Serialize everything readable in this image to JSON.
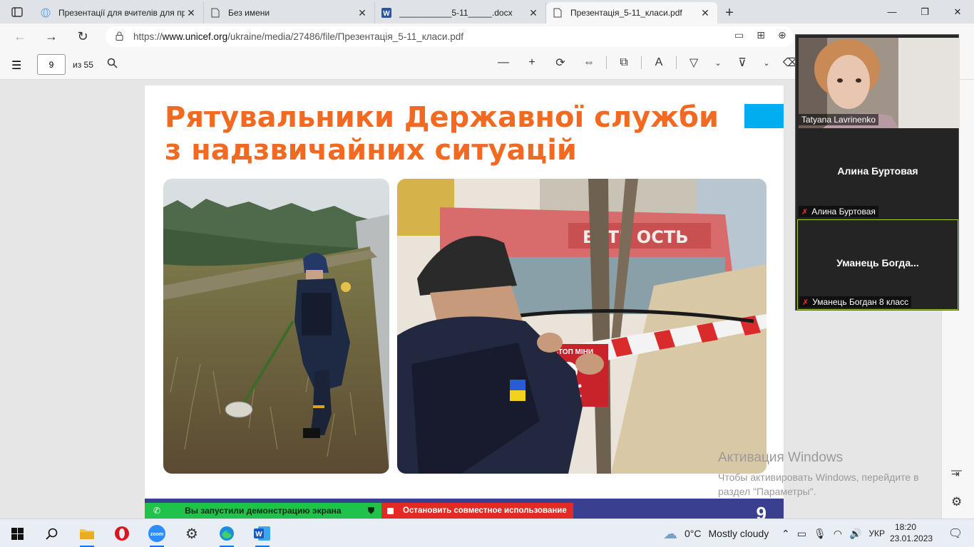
{
  "browser": {
    "tabs": [
      {
        "title": "Презентації для вчителів для пр",
        "icon": "globe-icon"
      },
      {
        "title": "Без имени",
        "icon": "document-icon"
      },
      {
        "title": "___________5-11_____.docx",
        "icon": "word-icon"
      },
      {
        "title": "Презентація_5-11_класи.pdf",
        "icon": "document-icon",
        "active": true
      }
    ],
    "url_host": "www.unicef.org",
    "url_prefix": "https://",
    "url_path": "/ukraine/media/27486/file/Презентація_5-11_класи.pdf"
  },
  "pdf": {
    "current_page": "9",
    "total_pages": "из 55"
  },
  "slide": {
    "title_line1": "Рятувальники Державної служби",
    "title_line2": "з надзвичайних ситуацій",
    "sign_text": "СТОП МІНИ",
    "store_sign": "ВЕТЕ  ОСТЬ",
    "page_number": "9",
    "colors": {
      "title": "#f26a21",
      "accent": "#00aeef",
      "footer": "#3b3f8f"
    }
  },
  "watermark": {
    "line1": "Активация Windows",
    "line2": "Чтобы активировать Windows, перейдите в",
    "line3": "раздел \"Параметры\"."
  },
  "zoom": {
    "participants": [
      {
        "label": "Tatyana Lavrinenko",
        "video": true
      },
      {
        "display_name": "Алина Буртовая",
        "label": "Алина Буртовая",
        "muted": true
      },
      {
        "display_name": "Уманець  Богда...",
        "label": "Уманець Богдан 8 класс",
        "muted": true,
        "active": true
      }
    ],
    "share_banner": "Вы запустили демонстрацию экрана",
    "stop_share": "Остановить совместное использование"
  },
  "taskbar": {
    "weather_temp": "0°C",
    "weather_desc": "Mostly cloudy",
    "language": "УКР",
    "time": "18:20",
    "date": "23.01.2023"
  }
}
